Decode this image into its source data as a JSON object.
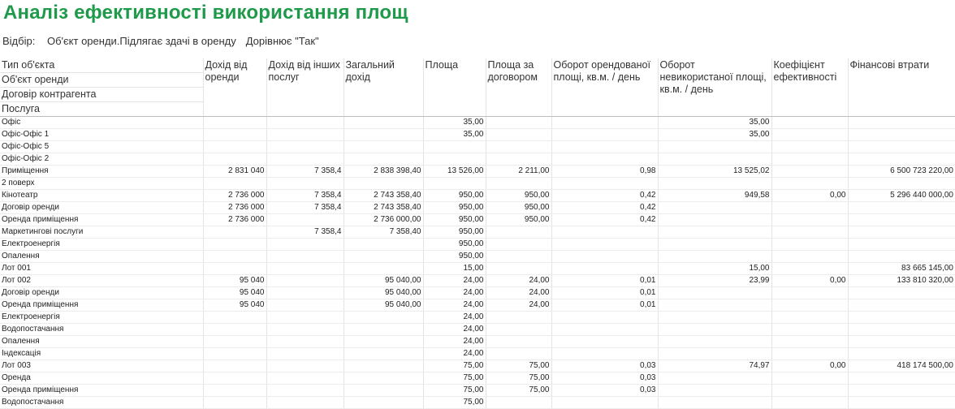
{
  "title": "Аналіз ефективності використання площ",
  "filter": {
    "label": "Відбір:",
    "field": "Об'єкт оренди.Підлягає здачі в оренду",
    "condition": "Дорівнює \"Так\""
  },
  "table": {
    "group_headers": [
      "Тип об'єкта",
      "Об'єкт оренди",
      "Договір контрагента",
      "Послуга"
    ],
    "columns": [
      "Дохід від оренди",
      "Дохід від інших послуг",
      "Загальний дохід",
      "Площа",
      "Площа за договором",
      "Оборот орендованої площі, кв.м. / день",
      "Оборот невикористаної площі, кв.м. / день",
      "Коефіцієнт ефективності",
      "Фінансові втрати"
    ],
    "rows": [
      {
        "level": 0,
        "name": "Офіс",
        "values": [
          "",
          "",
          "",
          "35,00",
          "",
          "",
          "35,00",
          "",
          ""
        ]
      },
      {
        "level": 1,
        "name": "Офіс-Офіс 1",
        "values": [
          "",
          "",
          "",
          "35,00",
          "",
          "",
          "35,00",
          "",
          ""
        ]
      },
      {
        "level": 1,
        "name": "Офіс-Офіс 5",
        "values": [
          "",
          "",
          "",
          "",
          "",
          "",
          "",
          "",
          ""
        ]
      },
      {
        "level": 1,
        "name": "Офіс-Офіс 2",
        "values": [
          "",
          "",
          "",
          "",
          "",
          "",
          "",
          "",
          ""
        ]
      },
      {
        "level": 0,
        "name": "Приміщення",
        "values": [
          "2 831 040",
          "7 358,4",
          "2 838 398,40",
          "13 526,00",
          "2 211,00",
          "0,98",
          "13 525,02",
          "",
          "6 500 723 220,00"
        ]
      },
      {
        "level": 1,
        "name": "2 поверх",
        "values": [
          "",
          "",
          "",
          "",
          "",
          "",
          "",
          "",
          ""
        ]
      },
      {
        "level": 1,
        "name": "Кінотеатр",
        "values": [
          "2 736 000",
          "7 358,4",
          "2 743 358,40",
          "950,00",
          "950,00",
          "0,42",
          "949,58",
          "0,00",
          "5 296 440 000,00"
        ]
      },
      {
        "level": 2,
        "name": "Договір оренди",
        "values": [
          "2 736 000",
          "7 358,4",
          "2 743 358,40",
          "950,00",
          "950,00",
          "0,42",
          "",
          "",
          ""
        ]
      },
      {
        "level": 3,
        "name": "Оренда приміщення",
        "values": [
          "2 736 000",
          "",
          "2 736 000,00",
          "950,00",
          "950,00",
          "0,42",
          "",
          "",
          ""
        ]
      },
      {
        "level": 3,
        "name": "Маркетингові послуги",
        "values": [
          "",
          "7 358,4",
          "7 358,40",
          "950,00",
          "",
          "",
          "",
          "",
          ""
        ]
      },
      {
        "level": 3,
        "name": "Електроенергія",
        "values": [
          "",
          "",
          "",
          "950,00",
          "",
          "",
          "",
          "",
          ""
        ]
      },
      {
        "level": 3,
        "name": "Опалення",
        "values": [
          "",
          "",
          "",
          "950,00",
          "",
          "",
          "",
          "",
          ""
        ]
      },
      {
        "level": 1,
        "name": "Лот 001",
        "values": [
          "",
          "",
          "",
          "15,00",
          "",
          "",
          "15,00",
          "",
          "83 665 145,00"
        ]
      },
      {
        "level": 1,
        "name": "Лот 002",
        "values": [
          "95 040",
          "",
          "95 040,00",
          "24,00",
          "24,00",
          "0,01",
          "23,99",
          "0,00",
          "133 810 320,00"
        ]
      },
      {
        "level": 2,
        "name": "Договір оренди",
        "values": [
          "95 040",
          "",
          "95 040,00",
          "24,00",
          "24,00",
          "0,01",
          "",
          "",
          ""
        ]
      },
      {
        "level": 3,
        "name": "Оренда приміщення",
        "values": [
          "95 040",
          "",
          "95 040,00",
          "24,00",
          "24,00",
          "0,01",
          "",
          "",
          ""
        ]
      },
      {
        "level": 3,
        "name": "Електроенергія",
        "values": [
          "",
          "",
          "",
          "24,00",
          "",
          "",
          "",
          "",
          ""
        ]
      },
      {
        "level": 3,
        "name": "Водопостачання",
        "values": [
          "",
          "",
          "",
          "24,00",
          "",
          "",
          "",
          "",
          ""
        ]
      },
      {
        "level": 3,
        "name": "Опалення",
        "values": [
          "",
          "",
          "",
          "24,00",
          "",
          "",
          "",
          "",
          ""
        ]
      },
      {
        "level": 3,
        "name": "Індексація",
        "values": [
          "",
          "",
          "",
          "24,00",
          "",
          "",
          "",
          "",
          ""
        ]
      },
      {
        "level": 1,
        "name": "Лот 003",
        "values": [
          "",
          "",
          "",
          "75,00",
          "75,00",
          "0,03",
          "74,97",
          "0,00",
          "418 174 500,00"
        ]
      },
      {
        "level": 2,
        "name": "Оренда",
        "values": [
          "",
          "",
          "",
          "75,00",
          "75,00",
          "0,03",
          "",
          "",
          ""
        ]
      },
      {
        "level": 3,
        "name": "Оренда приміщення",
        "values": [
          "",
          "",
          "",
          "75,00",
          "75,00",
          "0,03",
          "",
          "",
          ""
        ]
      },
      {
        "level": 3,
        "name": "Водопостачання",
        "values": [
          "",
          "",
          "",
          "75,00",
          "",
          "",
          "",
          "",
          ""
        ]
      }
    ]
  }
}
